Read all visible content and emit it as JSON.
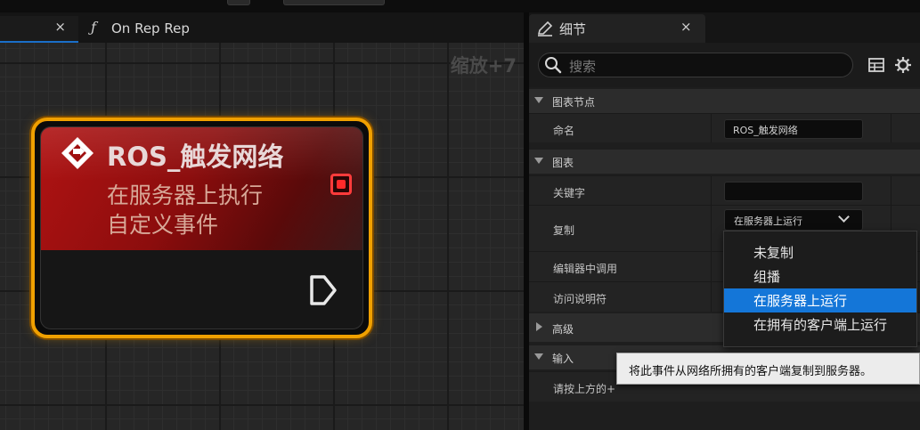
{
  "graph_tabs": [
    {
      "label": "",
      "close": "×",
      "active": true
    },
    {
      "icon": "function-icon",
      "label": "On Rep Rep"
    }
  ],
  "graph": {
    "zoom_label": "缩放+7",
    "node": {
      "title": "ROS_触发网络",
      "subtitle_line1": "在服务器上执行",
      "subtitle_line2": "自定义事件",
      "header_color": "#a01010",
      "border_color": "#f0a000",
      "pin_color": "#ff3b3b"
    }
  },
  "details": {
    "tab_label": "细节",
    "tab_close": "×",
    "search_placeholder": "搜索",
    "categories": {
      "graph_node": "图表节点",
      "graph": "图表",
      "advanced": "高级",
      "inputs": "输入"
    },
    "props": {
      "name_label": "命名",
      "name_value": "ROS_触发网络",
      "keywords_label": "关键字",
      "keywords_value": "",
      "replication_label": "复制",
      "replication_value": "在服务器上运行",
      "call_in_editor_label": "编辑器中调用",
      "access_specifier_label": "访问说明符",
      "inputs_hint": "请按上方的+"
    },
    "replication_options": [
      "未复制",
      "组播",
      "在服务器上运行",
      "在拥有的客户端上运行"
    ],
    "replication_selected_index": 2,
    "tooltip": "将此事件从网络所拥有的客户端复制到服务器。",
    "accent_color": "#1476d8"
  }
}
